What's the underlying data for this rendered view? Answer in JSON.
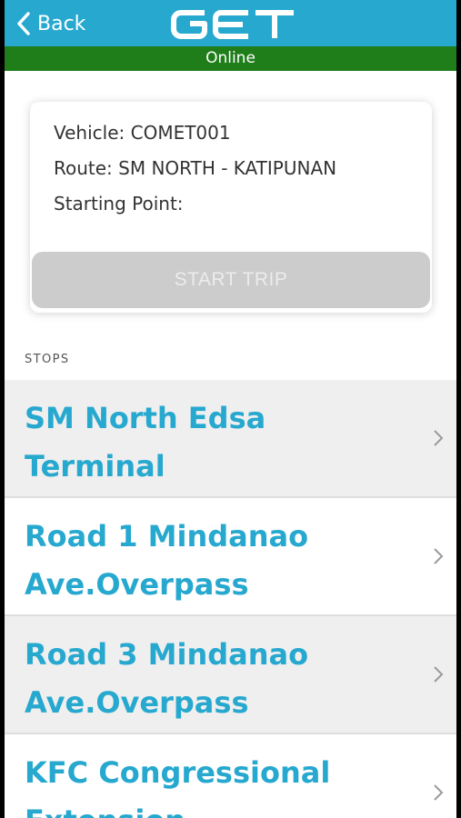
{
  "header": {
    "back_label": "Back",
    "logo_text": "GET",
    "status": "Online"
  },
  "trip": {
    "vehicle": "Vehicle: COMET001",
    "route": "Route: SM NORTH - KATIPUNAN",
    "starting_point": "Starting Point:",
    "start_button": "START TRIP"
  },
  "stops": {
    "header": "STOPS",
    "items": [
      {
        "name": "SM North Edsa Terminal"
      },
      {
        "name": "Road 1 Mindanao Ave.Overpass"
      },
      {
        "name": "Road 3 Mindanao Ave.Overpass"
      },
      {
        "name": "KFC Congressional Extension"
      }
    ]
  },
  "colors": {
    "brand": "#27a8cf",
    "online": "#1f7d1a",
    "disabled_button": "#cccccc"
  }
}
